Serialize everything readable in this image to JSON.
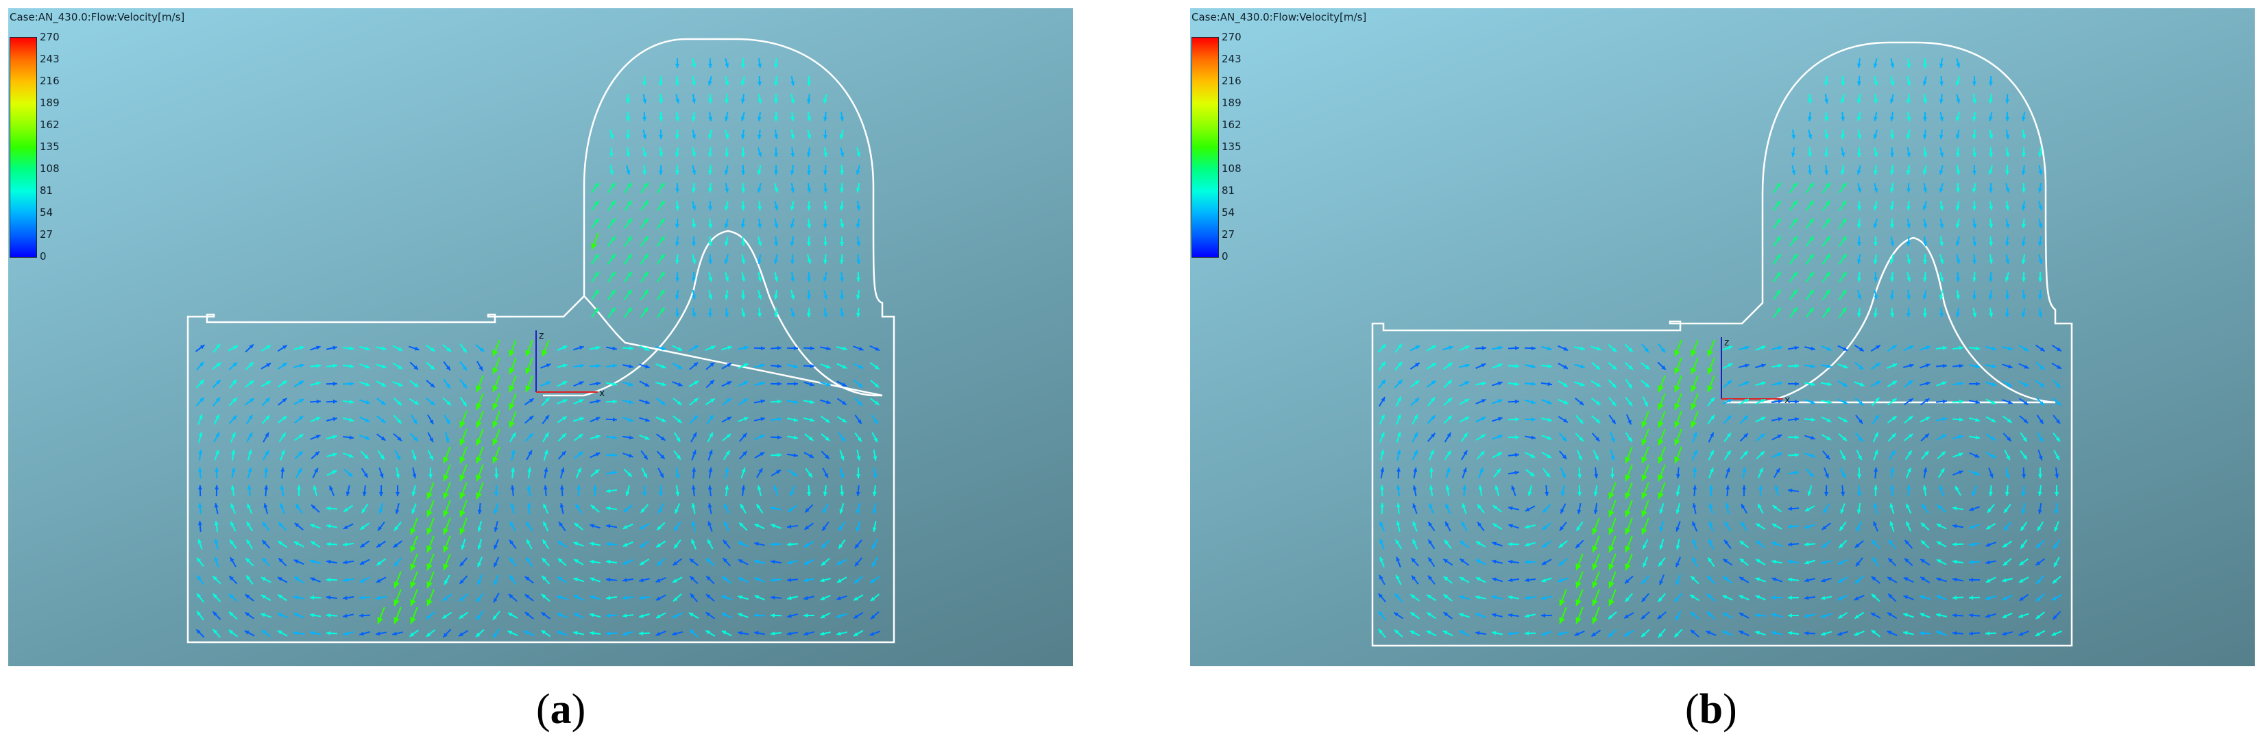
{
  "panels": [
    {
      "id": "a",
      "case_title": "Case:AN_430.0:Flow:Velocity[m/s]",
      "caption": "a",
      "colorbar_ticks": [
        "270",
        "243",
        "216",
        "189",
        "162",
        "135",
        "108",
        "81",
        "54",
        "27",
        "0"
      ],
      "axis_labels": {
        "z": "z",
        "x": "x"
      }
    },
    {
      "id": "b",
      "case_title": "Case:AN_430.0:Flow:Velocity[m/s]",
      "caption": "b",
      "colorbar_ticks": [
        "270",
        "243",
        "216",
        "189",
        "162",
        "135",
        "108",
        "81",
        "54",
        "27",
        "0"
      ],
      "axis_labels": {
        "z": "z",
        "x": "x"
      }
    }
  ],
  "colors": {
    "scale": [
      "#0000ff",
      "#0060ff",
      "#00b4ff",
      "#00ffe0",
      "#00ff80",
      "#30ff00",
      "#90ff00",
      "#e0ff00",
      "#ffc000",
      "#ff7000",
      "#ff0000"
    ],
    "outline": "#ffffff",
    "axis_x": "#e02020",
    "axis_z": "#2020c0"
  }
}
